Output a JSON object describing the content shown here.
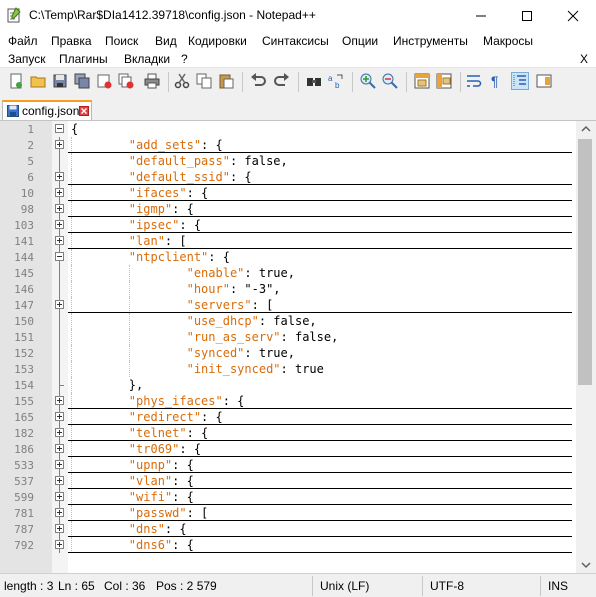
{
  "window": {
    "title": "C:\\Temp\\Rar$DIa1412.39718\\config.json - Notepad++"
  },
  "menu": {
    "row1": [
      "Файл",
      "Правка",
      "Поиск",
      "Вид",
      "Кодировки",
      "Синтаксисы",
      "Опции",
      "Инструменты",
      "Макросы"
    ],
    "row2": [
      "Запуск",
      "Плагины",
      "Вкладки",
      "?"
    ],
    "close_x": "X"
  },
  "toolbar": {
    "icons": [
      "new-file-icon",
      "open-file-icon",
      "save-icon",
      "save-all-icon",
      "close-icon",
      "close-all-icon",
      "print-icon",
      "cut-icon",
      "copy-icon",
      "paste-icon",
      "undo-icon",
      "redo-icon",
      "find-icon",
      "replace-icon",
      "zoom-in-icon",
      "zoom-out-icon",
      "sync-vertical-icon",
      "sync-horizontal-icon",
      "word-wrap-icon",
      "show-all-chars-icon",
      "indent-guide-icon",
      "doc-map-icon"
    ]
  },
  "tab": {
    "label": "config.json"
  },
  "editor": {
    "lines": [
      {
        "n": "1",
        "text": "{"
      },
      {
        "n": "2",
        "indent": "        ",
        "key": "\"add_sets\"",
        "rest": ": {"
      },
      {
        "n": "5",
        "indent": "        ",
        "key": "\"default_pass\"",
        "rest": ": false,"
      },
      {
        "n": "6",
        "indent": "        ",
        "key": "\"default_ssid\"",
        "rest": ": {"
      },
      {
        "n": "10",
        "indent": "        ",
        "key": "\"ifaces\"",
        "rest": ": {"
      },
      {
        "n": "98",
        "indent": "        ",
        "key": "\"igmp\"",
        "rest": ": {"
      },
      {
        "n": "103",
        "indent": "        ",
        "key": "\"ipsec\"",
        "rest": ": {"
      },
      {
        "n": "141",
        "indent": "        ",
        "key": "\"lan\"",
        "rest": ": ["
      },
      {
        "n": "144",
        "indent": "        ",
        "key": "\"ntpclient\"",
        "rest": ": {"
      },
      {
        "n": "145",
        "indent": "                ",
        "key": "\"enable\"",
        "rest": ": true,"
      },
      {
        "n": "146",
        "indent": "                ",
        "key": "\"hour\"",
        "rest": ": \"-3\","
      },
      {
        "n": "147",
        "indent": "                ",
        "key": "\"servers\"",
        "rest": ": ["
      },
      {
        "n": "150",
        "indent": "                ",
        "key": "\"use_dhcp\"",
        "rest": ": false,"
      },
      {
        "n": "151",
        "indent": "                ",
        "key": "\"run_as_serv\"",
        "rest": ": false,"
      },
      {
        "n": "152",
        "indent": "                ",
        "key": "\"synced\"",
        "rest": ": true,"
      },
      {
        "n": "153",
        "indent": "                ",
        "key": "\"init_synced\"",
        "rest": ": true"
      },
      {
        "n": "154",
        "text": "        },"
      },
      {
        "n": "155",
        "indent": "        ",
        "key": "\"phys_ifaces\"",
        "rest": ": {"
      },
      {
        "n": "165",
        "indent": "        ",
        "key": "\"redirect\"",
        "rest": ": {"
      },
      {
        "n": "182",
        "indent": "        ",
        "key": "\"telnet\"",
        "rest": ": {"
      },
      {
        "n": "186",
        "indent": "        ",
        "key": "\"tr069\"",
        "rest": ": {"
      },
      {
        "n": "533",
        "indent": "        ",
        "key": "\"upnp\"",
        "rest": ": {"
      },
      {
        "n": "537",
        "indent": "        ",
        "key": "\"vlan\"",
        "rest": ": {"
      },
      {
        "n": "599",
        "indent": "        ",
        "key": "\"wifi\"",
        "rest": ": {"
      },
      {
        "n": "781",
        "indent": "        ",
        "key": "\"passwd\"",
        "rest": ": ["
      },
      {
        "n": "787",
        "indent": "        ",
        "key": "\"dns\"",
        "rest": ": {"
      },
      {
        "n": "792",
        "indent": "        ",
        "key": "\"dns6\"",
        "rest": ": {"
      }
    ]
  },
  "status": {
    "length": "length : 3",
    "ln": "Ln : 65",
    "col": "Col : 36",
    "pos": "Pos : 2 579",
    "eol": "Unix (LF)",
    "encoding": "UTF-8",
    "mode": "INS"
  }
}
